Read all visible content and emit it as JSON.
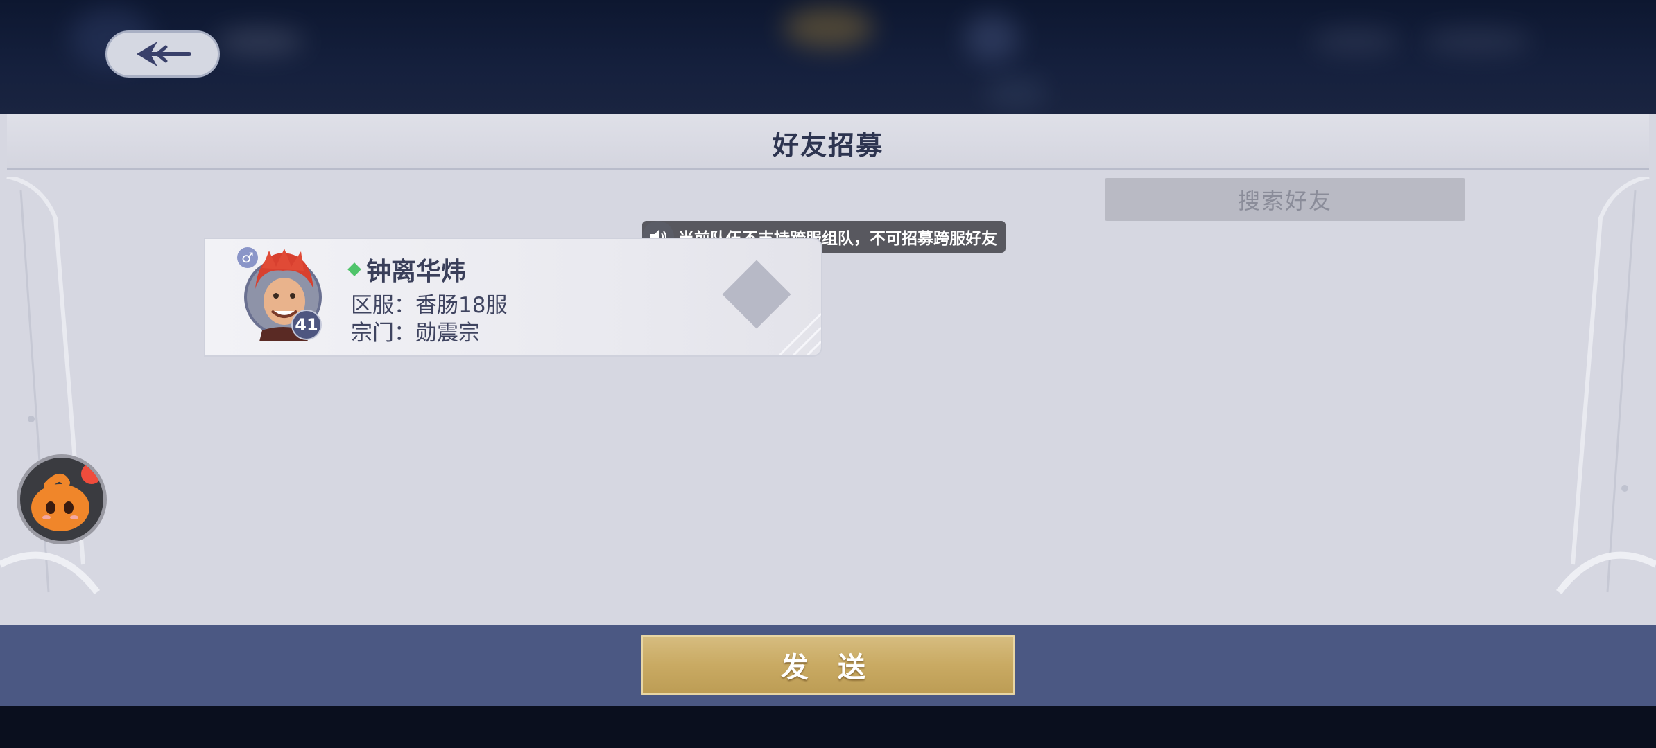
{
  "header": {
    "back_icon": "back-arrow-icon"
  },
  "panel": {
    "title": "好友招募",
    "search_button_label": "搜索好友"
  },
  "toast": {
    "icon": "speaker-icon",
    "message": "当前队伍不支持跨服组队，不可招募跨服好友"
  },
  "friends": [
    {
      "gender_icon": "male-icon",
      "level": "41",
      "online_icon": "green-diamond-icon",
      "name": "钟离华炜",
      "server_line": "区服：香肠18服",
      "sect_line": "宗门：勋震宗"
    }
  ],
  "footer": {
    "send_button_label": "发 送"
  },
  "colors": {
    "panel_bg": "#d6d7e1",
    "bottom_bar": "#4b5883",
    "send_gold": "#c9aa63",
    "online_green": "#4fc46a",
    "notification_red": "#f04c3c"
  }
}
